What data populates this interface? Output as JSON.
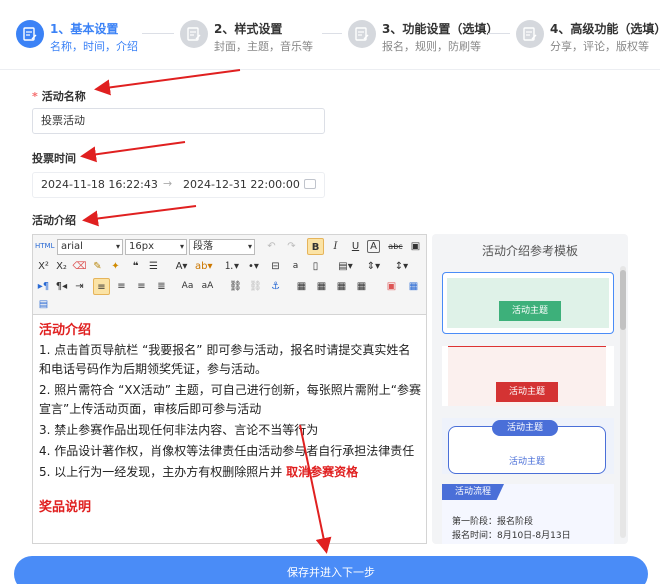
{
  "steps": [
    {
      "title": "1、基本设置",
      "desc": "名称，时间，介绍",
      "active": true
    },
    {
      "title": "2、样式设置",
      "desc": "封面，主题，音乐等",
      "active": false
    },
    {
      "title": "3、功能设置（选填）",
      "desc": "报名，规则，防刷等",
      "active": false
    },
    {
      "title": "4、高级功能（选填）",
      "desc": "分享，评论，版权等",
      "active": false
    }
  ],
  "form": {
    "name_label": "活动名称",
    "required_mark": "*",
    "name_value": "投票活动",
    "time_label": "投票时间",
    "start_time": "2024-11-18 16:22:43",
    "range_sep": "→",
    "end_time": "2024-12-31 22:00:00",
    "intro_label": "活动介绍"
  },
  "toolbar": {
    "font_family": "arial",
    "font_size": "16px",
    "paragraph": "段落"
  },
  "content": {
    "heading": "活动介绍",
    "items": [
      "1. 点击首页导航栏 “我要报名” 即可参与活动，报名时请提交真实姓名和电话号码作为后期领奖凭证，参与活动。",
      "2. 照片需符合 “XX活动” 主题，可自己进行创新，每张照片需附上“参赛宣言”上传活动页面，审核后即可参与活动",
      "3. 禁止参赛作品出现任何非法内容、言论不当等行为",
      "4. 作品设计著作权，肖像权等法律责任由活动参与者自行承担法律责任"
    ],
    "item5_prefix": "5. 以上行为一经发现，主办方有权删除照片并 ",
    "item5_highlight": "取消参赛资格",
    "heading2": "奖品说明"
  },
  "templates": {
    "title": "活动介绍参考模板",
    "card1": "活动主题",
    "card2": "活动主题",
    "card3": "活动主题",
    "card3_sub": "活动主题",
    "card4_tag": "活动流程",
    "card4_line1": "第一阶段：报名阶段",
    "card4_line2": "报名时间：8月10日-8月13日"
  },
  "save_button": "保存并进入下一步",
  "colors": {
    "accent": "#3b82f6",
    "annotation": "#e02020"
  }
}
